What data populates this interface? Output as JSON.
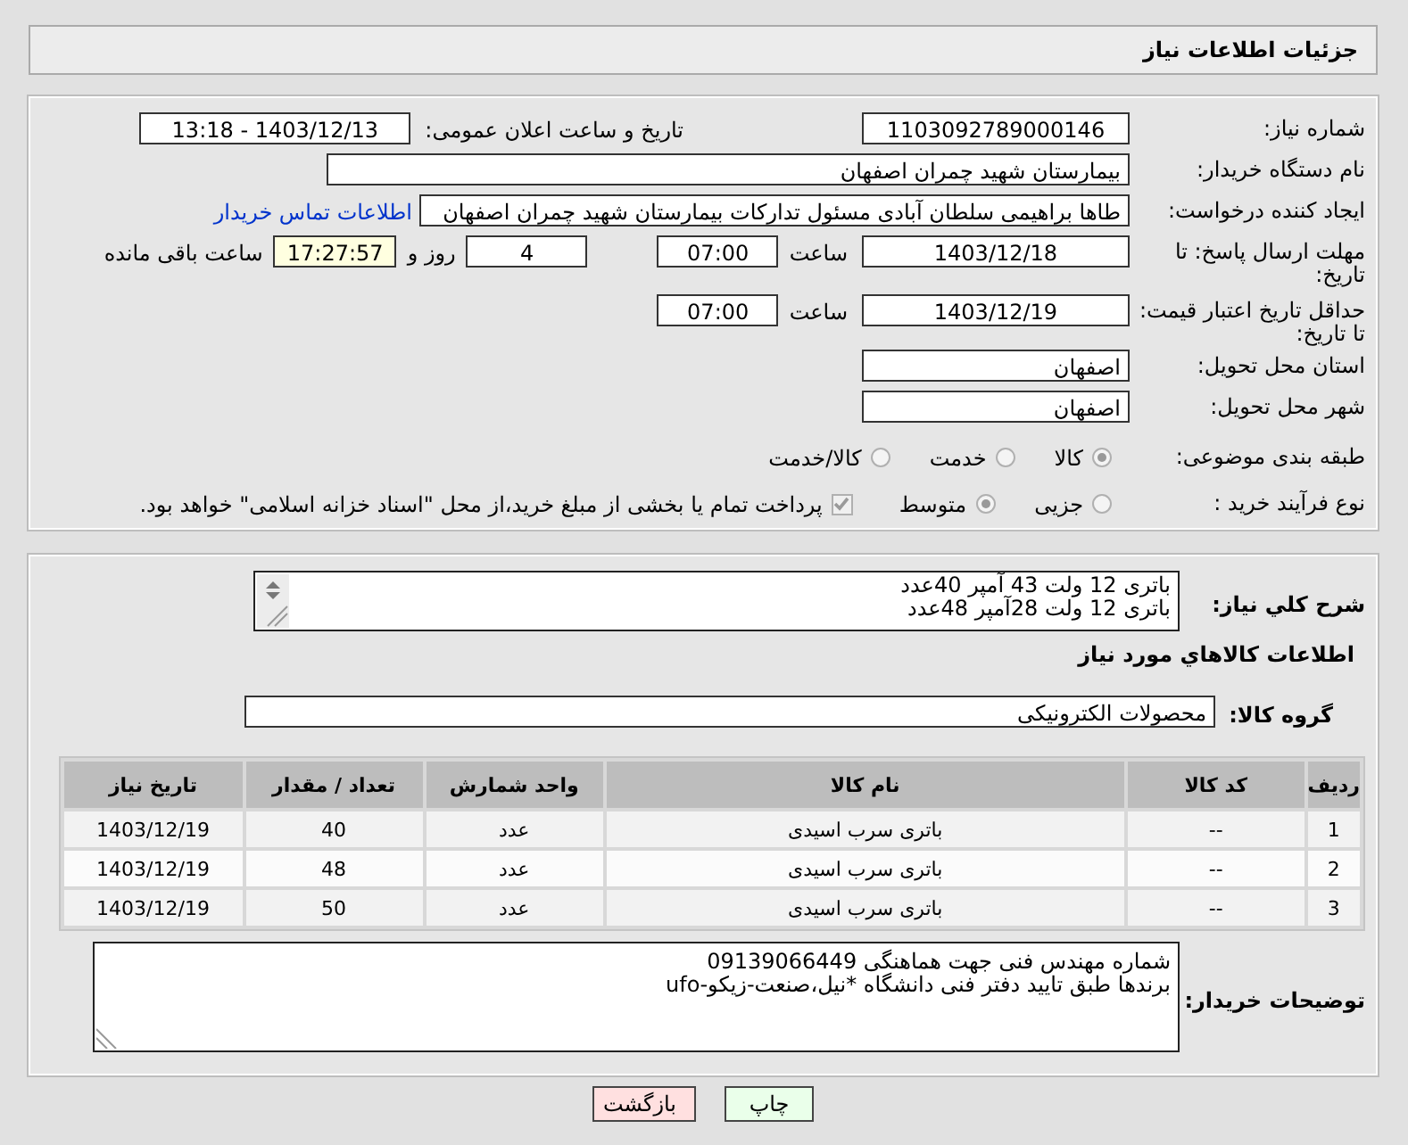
{
  "header": {
    "title": "جزئیات اطلاعات نیاز"
  },
  "need_number": {
    "label": "شماره نیاز:",
    "value": "1103092789000146"
  },
  "announce": {
    "label": "تاریخ و ساعت اعلان عمومی:",
    "value": "1403/12/13 - 13:18"
  },
  "buyer": {
    "label": "نام دستگاه خریدار:",
    "value": "بیمارستان شهید چمران اصفهان"
  },
  "requester": {
    "label": "ایجاد کننده درخواست:",
    "value": "طاها براهیمی سلطان آبادی مسئول تدارکات  بیمارستان شهید چمران اصفهان",
    "link": "اطلاعات تماس خریدار"
  },
  "reply_deadline": {
    "label": "مهلت ارسال پاسخ: تا تاریخ:",
    "date": "1403/12/18",
    "time_label": "ساعت",
    "time": "07:00",
    "days": "4",
    "days_label": "روز و",
    "remaining": "17:27:57",
    "remaining_label": "ساعت باقی مانده"
  },
  "price_validity": {
    "label": "حداقل تاریخ اعتبار قیمت: تا تاریخ:",
    "date": "1403/12/19",
    "time_label": "ساعت",
    "time": "07:00"
  },
  "province": {
    "label": "استان محل تحویل:",
    "value": "اصفهان"
  },
  "city": {
    "label": "شهر محل تحویل:",
    "value": "اصفهان"
  },
  "category": {
    "label": "طبقه بندی موضوعی:",
    "options": [
      {
        "label": "کالا",
        "selected": true
      },
      {
        "label": "خدمت",
        "selected": false
      },
      {
        "label": "کالا/خدمت",
        "selected": false
      }
    ]
  },
  "process": {
    "label": "نوع فرآیند خرید :",
    "options": [
      {
        "label": "جزیی",
        "selected": false
      },
      {
        "label": "متوسط",
        "selected": true
      }
    ],
    "payment": {
      "checked": true,
      "text": "پرداخت تمام یا بخشی از مبلغ خرید،از محل \"اسناد خزانه اسلامی\" خواهد بود."
    }
  },
  "description": {
    "label": "شرح کلي نياز:",
    "lines": [
      "باتری 12 ولت 43 آمپر 40عدد",
      "باتری 12 ولت 28آمپر 48عدد"
    ]
  },
  "goods_title": "اطلاعات کالاهاي مورد نياز",
  "goods_group": {
    "label": "گروه کالا:",
    "value": "محصولات الکترونیکی"
  },
  "table": {
    "columns": [
      "ردیف",
      "کد کالا",
      "نام کالا",
      "واحد شمارش",
      "تعداد / مقدار",
      "تاریخ نیاز"
    ],
    "rows": [
      [
        "1",
        "--",
        "باتری سرب اسیدی",
        "عدد",
        "40",
        "1403/12/19"
      ],
      [
        "2",
        "--",
        "باتری سرب اسیدی",
        "عدد",
        "48",
        "1403/12/19"
      ],
      [
        "3",
        "--",
        "باتری سرب اسیدی",
        "عدد",
        "50",
        "1403/12/19"
      ]
    ]
  },
  "buyer_notes": {
    "label": "توضیحات خریدار:",
    "lines": [
      "شماره مهندس فنی جهت هماهنگی 09139066449",
      "برندها طبق تایید دفتر فنی دانشگاه *نیل،صنعت-زیکو-ufo"
    ]
  },
  "buttons": [
    {
      "label": "چاپ",
      "kind": "print"
    },
    {
      "label": "بازگشت",
      "kind": "back"
    }
  ]
}
